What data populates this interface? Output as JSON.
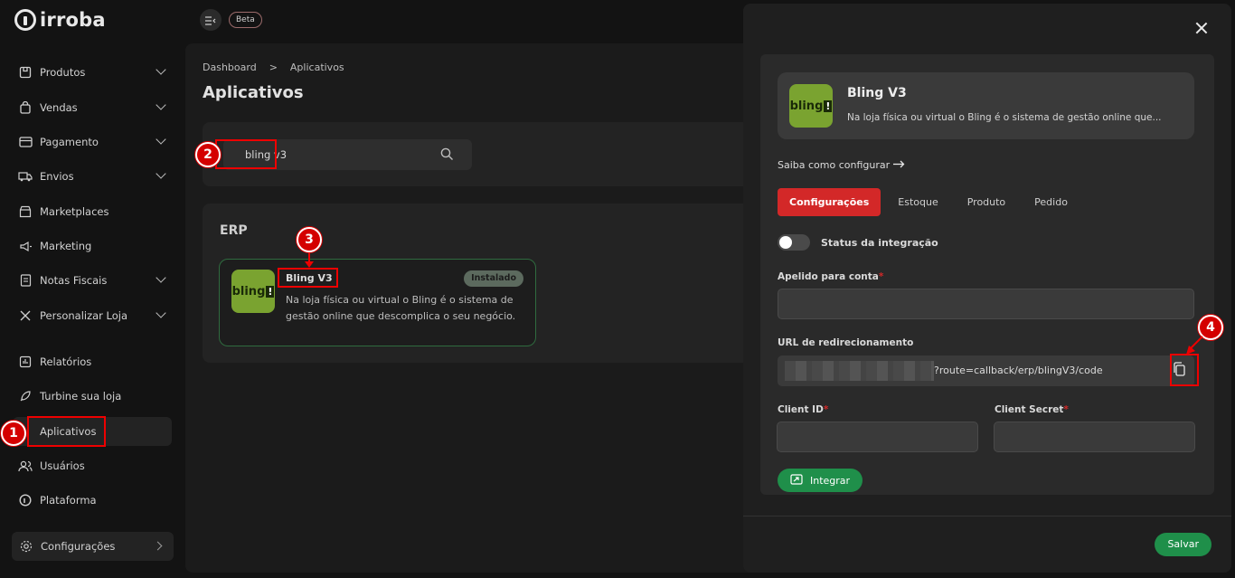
{
  "brand": {
    "logo_text": "irroba"
  },
  "topbar": {
    "beta_label": "Beta"
  },
  "sidebar": {
    "items": [
      {
        "label": "Produtos",
        "icon": "box-icon",
        "has_chevron": true
      },
      {
        "label": "Vendas",
        "icon": "shopping-bag-icon",
        "has_chevron": true
      },
      {
        "label": "Pagamento",
        "icon": "credit-card-icon",
        "has_chevron": true
      },
      {
        "label": "Envios",
        "icon": "truck-icon",
        "has_chevron": true
      },
      {
        "label": "Marketplaces",
        "icon": "store-icon",
        "has_chevron": false
      },
      {
        "label": "Marketing",
        "icon": "megaphone-icon",
        "has_chevron": false
      },
      {
        "label": "Notas Fiscais",
        "icon": "receipt-icon",
        "has_chevron": true
      },
      {
        "label": "Personalizar Loja",
        "icon": "tools-icon",
        "has_chevron": true
      },
      {
        "label": "Relatórios",
        "icon": "chart-icon",
        "has_chevron": false
      },
      {
        "label": "Turbine sua loja",
        "icon": "rocket-icon",
        "has_chevron": false
      },
      {
        "label": "Aplicativos",
        "icon": "apps-icon",
        "has_chevron": false,
        "active": true
      },
      {
        "label": "Usuários",
        "icon": "users-icon",
        "has_chevron": false
      },
      {
        "label": "Plataforma",
        "icon": "platform-icon",
        "has_chevron": false
      }
    ],
    "config_label": "Configurações"
  },
  "main": {
    "breadcrumb": [
      "Dashboard",
      ">",
      "Aplicativos"
    ],
    "title": "Aplicativos",
    "search_value": "bling v3",
    "section_title": "ERP",
    "app_card": {
      "name": "Bling V3",
      "badge": "Instalado",
      "logo_text": "bling",
      "description": "Na loja física ou virtual o Bling é o sistema de gestão online que descomplica o seu negócio."
    }
  },
  "modal": {
    "app_name": "Bling V3",
    "app_desc": "Na loja física ou virtual o Bling é o sistema de gestão online que...",
    "logo_text": "bling",
    "learn_link": "Saiba como configurar",
    "tabs": [
      "Configurações",
      "Estoque",
      "Produto",
      "Pedido"
    ],
    "active_tab": "Configurações",
    "status_label": "Status da integração",
    "status_on": false,
    "nickname_label": "Apelido para conta",
    "nickname_value": "",
    "redirect_label": "URL de redirecionamento",
    "redirect_url_visible": "?route=callback/erp/blingV3/code",
    "client_id_label": "Client ID",
    "client_id_value": "",
    "client_secret_label": "Client Secret",
    "client_secret_value": "",
    "required_mark": "*",
    "integrate_label": "Integrar",
    "save_label": "Salvar"
  },
  "annotations": [
    "1",
    "2",
    "3",
    "4"
  ],
  "colors": {
    "accent_red": "#d32828",
    "success_green": "#1f8f4a",
    "installed_badge": "#5c6a5e",
    "bling_green": "#7aa330"
  }
}
